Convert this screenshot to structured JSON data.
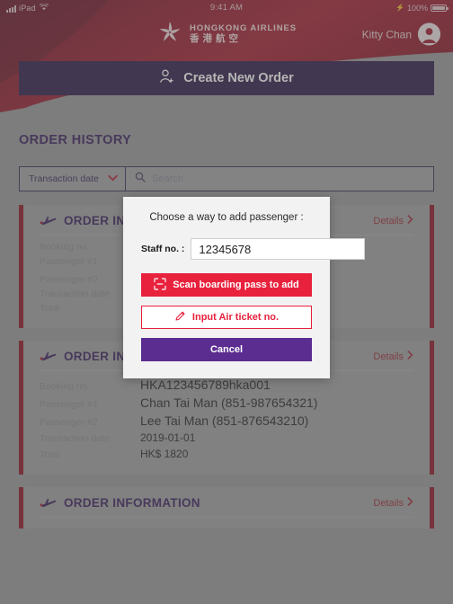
{
  "statusbar": {
    "carrier": "iPad",
    "wifi_icon": "wifi-icon",
    "time": "9:41 AM",
    "battery_percent": "100%",
    "charging_icon": "bolt-icon"
  },
  "header": {
    "brand_en": "HONGKONG AIRLINES",
    "brand_cn": "香港航空",
    "logo_icon": "bauhinia-logo-icon",
    "user_name": "Kitty Chan",
    "avatar_icon": "user-avatar-icon"
  },
  "toolbar": {
    "create_order_label": "Create New Order",
    "create_order_icon": "user-plus-icon"
  },
  "section": {
    "order_history_title": "ORDER HISTORY"
  },
  "filter": {
    "dropdown_value": "Transaction date",
    "dropdown_icon": "chevron-down-icon",
    "search_placeholder": "Search",
    "search_value": "",
    "search_icon": "search-icon"
  },
  "card_common": {
    "title": "ORDER INFORMATION",
    "plane_icon": "airplane-icon",
    "details_label": "Details",
    "details_icon": "chevron-right-icon",
    "labels": {
      "booking_no": "Booking no.",
      "passenger1": "Passenger #1",
      "passenger2": "Passenger #2",
      "transaction_date": "Transaction date",
      "total": "Total"
    }
  },
  "orders": [
    {
      "booking_no": "",
      "passenger1": "",
      "passenger2": ")",
      "transaction_date": "",
      "total": ""
    },
    {
      "booking_no": "HKA123456789hka001",
      "passenger1": "Chan Tai Man (851-987654321)",
      "passenger2": "Lee Tai Man (851-876543210)",
      "transaction_date": "2019-01-01",
      "total": "HK$ 1820"
    }
  ],
  "modal": {
    "title": "Choose a way to add passenger :",
    "staff_label": "Staff no. :",
    "staff_value": "12345678",
    "staff_placeholder": "",
    "scan_label": "Scan boarding pass to add",
    "scan_icon": "scan-frame-icon",
    "input_label": "Input Air ticket no.",
    "input_icon": "pencil-icon",
    "cancel_label": "Cancel"
  },
  "colors": {
    "brand_red": "#9e1b2f",
    "banner_dark": "#6b1528",
    "accent_red": "#e8213c",
    "purple_dark": "#2e1a47",
    "purple": "#5b2d90",
    "card_stripe": "#8e1322",
    "page_bg": "#9a9a9a"
  }
}
